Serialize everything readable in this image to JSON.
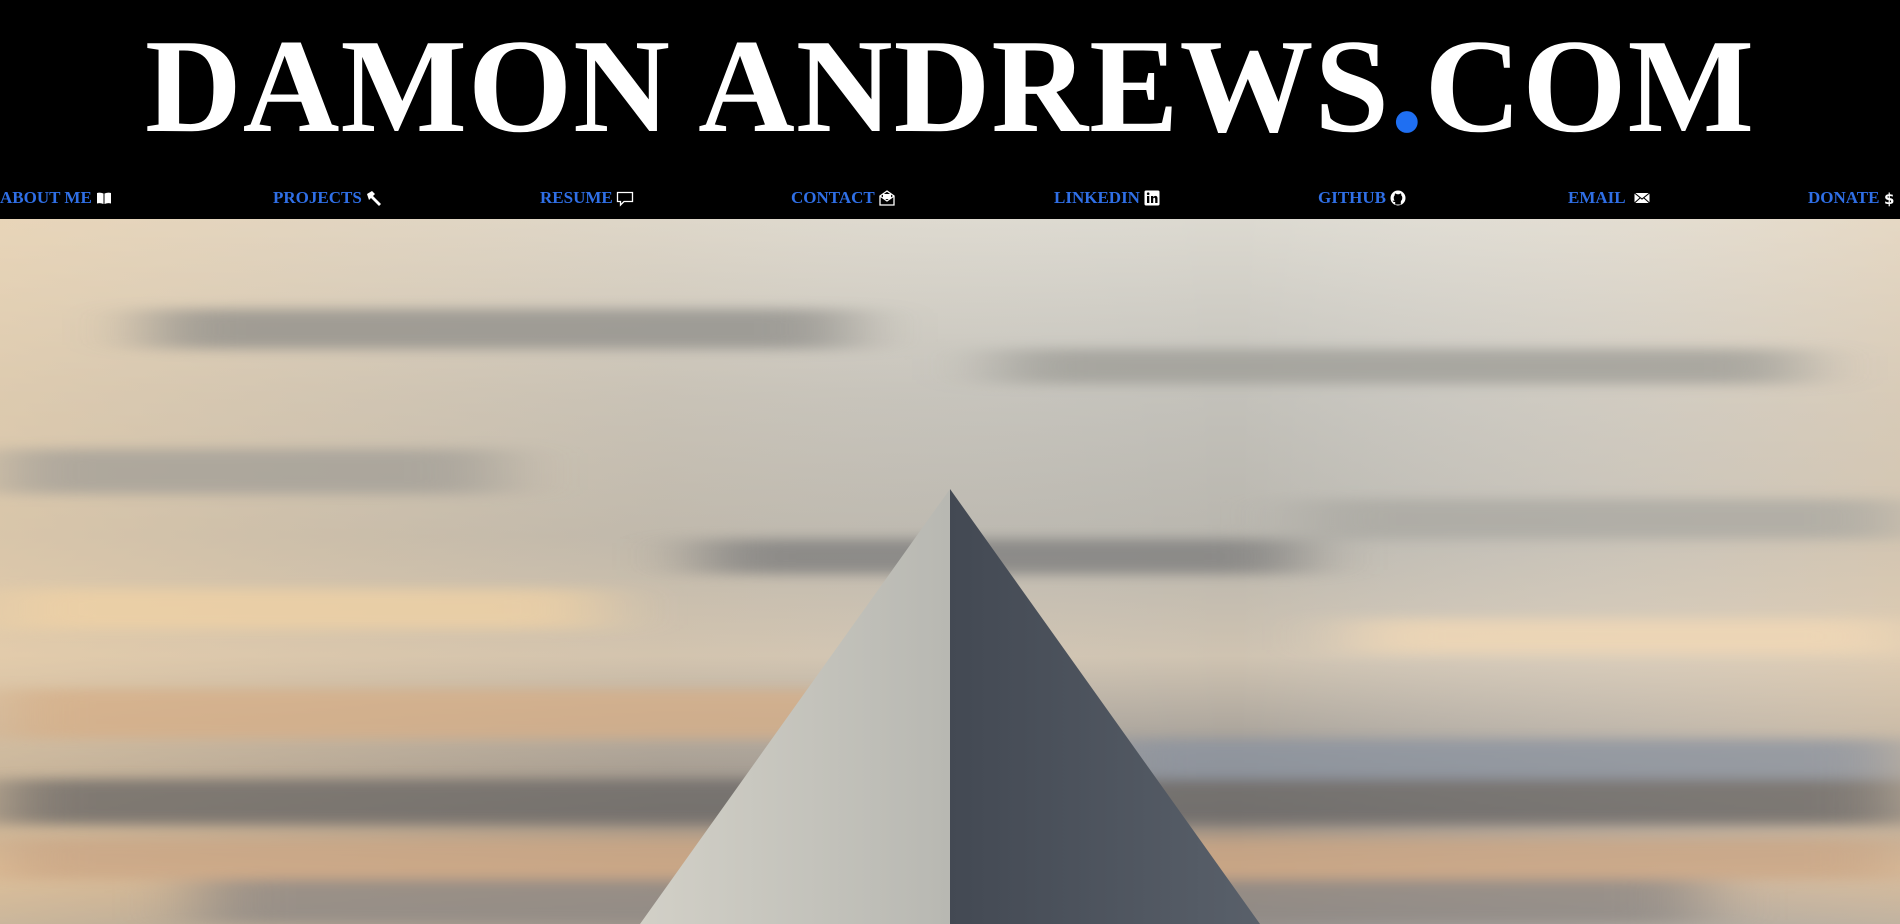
{
  "site": {
    "title_main": "DAMON ANDREWS",
    "title_dot": ".",
    "title_tld": "COM"
  },
  "nav": {
    "items": [
      {
        "label": "ABOUT ME",
        "icon": "book-icon"
      },
      {
        "label": "PROJECTS",
        "icon": "hammer-icon"
      },
      {
        "label": "RESUME",
        "icon": "speech-bubble-icon"
      },
      {
        "label": "CONTACT",
        "icon": "envelope-open-icon"
      },
      {
        "label": "LINKEDIN",
        "icon": "linkedin-icon"
      },
      {
        "label": "GITHUB",
        "icon": "github-icon"
      },
      {
        "label": "EMAIL",
        "icon": "envelope-icon"
      },
      {
        "label": "DONATE",
        "icon": "dollar-icon"
      }
    ]
  },
  "colors": {
    "header_bg": "#000000",
    "title": "#ffffff",
    "accent_dot": "#1f6ff2",
    "nav_link": "#2f6fe6"
  },
  "hero": {
    "image": "pyramid-under-cloudy-sky"
  }
}
